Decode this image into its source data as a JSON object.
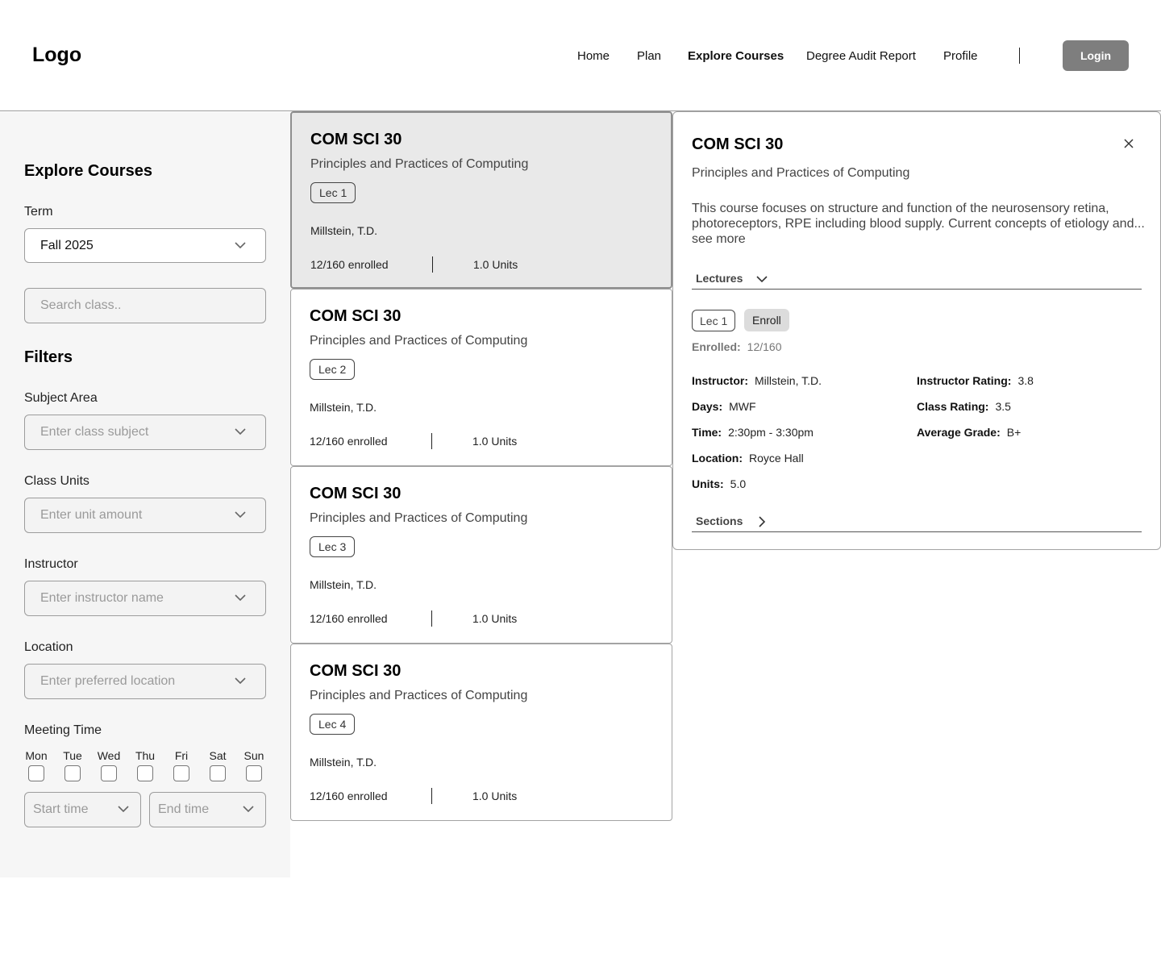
{
  "header": {
    "logo": "Logo",
    "nav": [
      "Home",
      "Plan",
      "Explore Courses",
      "Degree Audit Report",
      "Profile"
    ],
    "active_nav": "Explore Courses",
    "login": "Login"
  },
  "sidebar": {
    "title": "Explore Courses",
    "term_label": "Term",
    "term_value": "Fall 2025",
    "search_placeholder": "Search class..",
    "filters_title": "Filters",
    "subject_label": "Subject Area",
    "subject_placeholder": "Enter class subject",
    "units_label": "Class Units",
    "units_placeholder": "Enter unit amount",
    "instructor_label": "Instructor",
    "instructor_placeholder": "Enter instructor name",
    "location_label": "Location",
    "location_placeholder": "Enter preferred location",
    "meeting_label": "Meeting Time",
    "days": [
      "Mon",
      "Tue",
      "Wed",
      "Thu",
      "Fri",
      "Sat",
      "Sun"
    ],
    "start_time": "Start time",
    "end_time": "End time"
  },
  "cards": [
    {
      "code": "COM SCI 30",
      "name": "Principles and Practices of Computing",
      "lecture": "Lec 1",
      "instructor": "Millstein, T.D.",
      "enrolled": "12/160 enrolled",
      "units": "1.0 Units"
    },
    {
      "code": "COM SCI 30",
      "name": "Principles and Practices of Computing",
      "lecture": "Lec 2",
      "instructor": "Millstein, T.D.",
      "enrolled": "12/160 enrolled",
      "units": "1.0 Units"
    },
    {
      "code": "COM SCI 30",
      "name": "Principles and Practices of Computing",
      "lecture": "Lec 3",
      "instructor": "Millstein, T.D.",
      "enrolled": "12/160 enrolled",
      "units": "1.0 Units"
    },
    {
      "code": "COM SCI 30",
      "name": "Principles and Practices of Computing",
      "lecture": "Lec 4",
      "instructor": "Millstein, T.D.",
      "enrolled": "12/160 enrolled",
      "units": "1.0 Units"
    }
  ],
  "detail": {
    "code": "COM SCI 30",
    "name": "Principles and Practices of Computing",
    "description": "This course focuses on structure and function of the neurosensory retina, photoreceptors, RPE including blood supply. Current concepts of etiology and...",
    "see_more": "see more",
    "lectures_label": "Lectures",
    "lecture": "Lec 1",
    "enroll": "Enroll",
    "enrolled_label": "Enrolled:",
    "enrolled_value": "12/160",
    "instructor_label": "Instructor:",
    "instructor_value": "Millstein, T.D.",
    "days_label": "Days:",
    "days_value": "MWF",
    "time_label": "Time:",
    "time_value": "2:30pm - 3:30pm",
    "location_label": "Location:",
    "location_value": "Royce Hall",
    "units_label": "Units:",
    "units_value": "5.0",
    "instructor_rating_label": "Instructor Rating:",
    "instructor_rating_value": "3.8",
    "class_rating_label": "Class Rating:",
    "class_rating_value": "3.5",
    "avg_grade_label": "Average Grade:",
    "avg_grade_value": "B+",
    "sections_label": "Sections"
  }
}
